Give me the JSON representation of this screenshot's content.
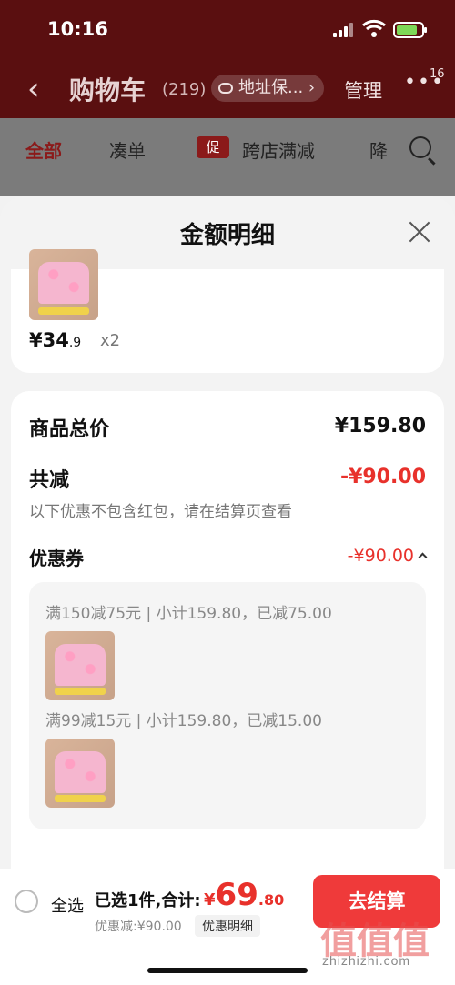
{
  "status_bar": {
    "time": "10:16"
  },
  "header": {
    "back_label": "‹",
    "title": "购物车",
    "count": "(219)",
    "address": "地址保... ›",
    "manage": "管理",
    "more": "•••",
    "badge": "16"
  },
  "tabs": {
    "all": "全部",
    "bundle": "凑单",
    "promo_tag": "促",
    "cross_store": "跨店满减",
    "more": "降"
  },
  "sheet": {
    "title": "金额明细",
    "item": {
      "price_main": "¥34",
      "price_dec": ".9",
      "qty": "x2"
    },
    "total_label": "商品总价",
    "total_value": "¥159.80",
    "reduce_label": "共减",
    "reduce_value": "-¥90.00",
    "hint": "以下优惠不包含红包，请在结算页查看",
    "coupon_label": "优惠券",
    "coupon_value": "-¥90.00",
    "rules": [
      "满150减75元 | 小计159.80，已减75.00",
      "满99减15元 | 小计159.80，已减15.00"
    ]
  },
  "bottom_bar": {
    "select_all": "全选",
    "summary": "已选1件,合计:",
    "total_currency": "¥",
    "total_int": "69",
    "total_dec": ".80",
    "discount": "优惠减:¥90.00",
    "detail_button": "优惠明细",
    "checkout": "去结算"
  },
  "watermark": {
    "glyphs": "值值值",
    "text": "zhizhizhi.com"
  },
  "colors": {
    "accent_red": "#e8312b",
    "header_dark": "#5a0f10",
    "checkout": "#ef3a3a"
  }
}
